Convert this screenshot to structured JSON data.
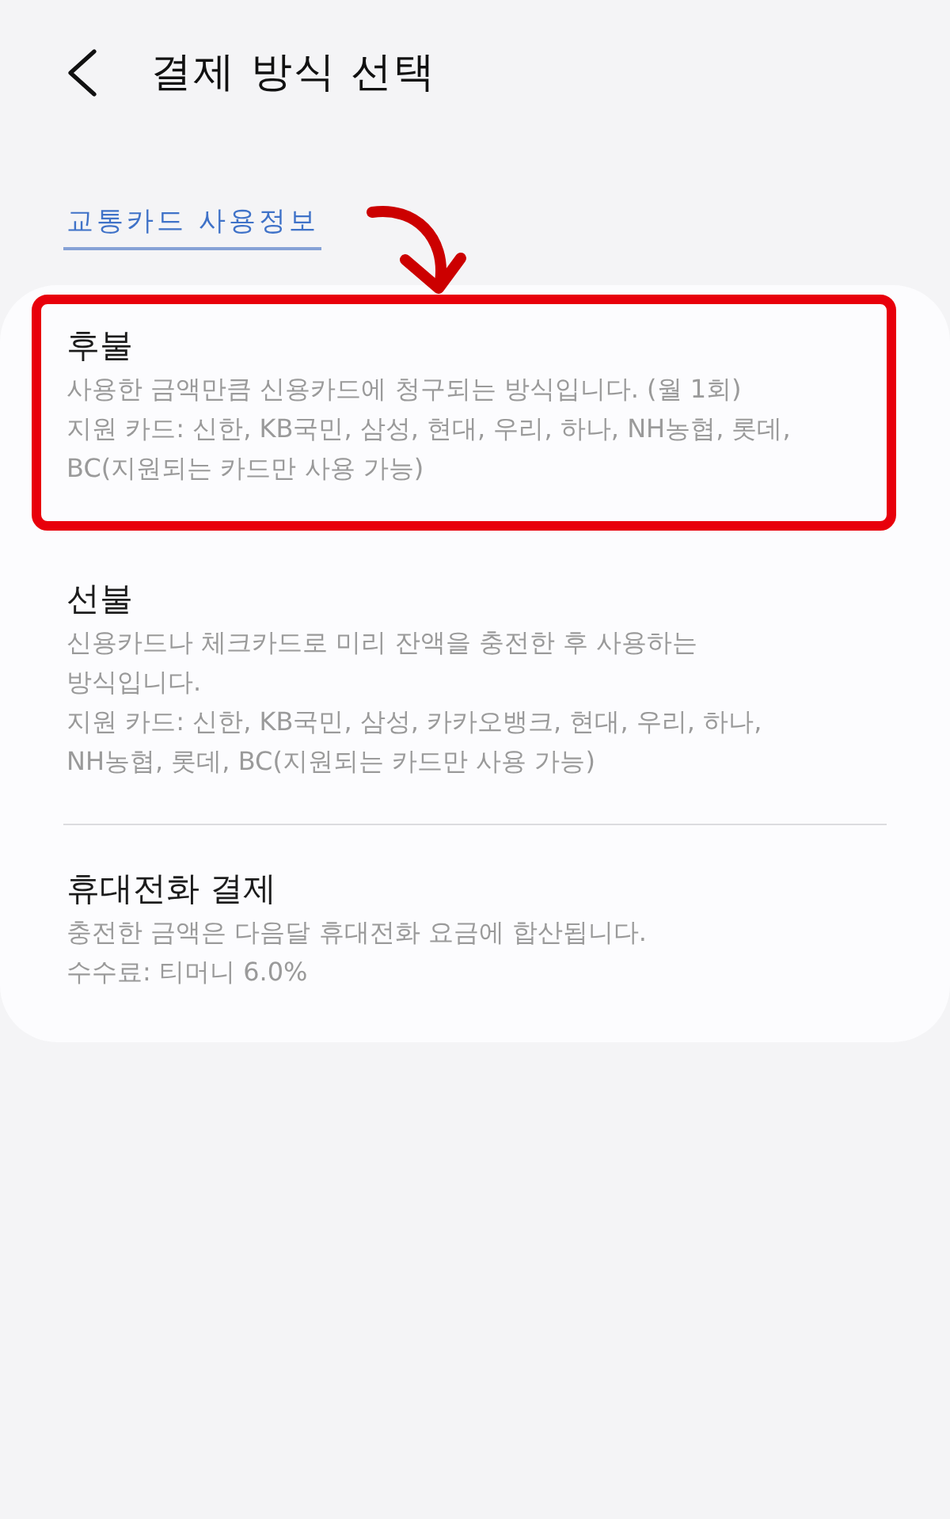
{
  "header": {
    "title": "결제 방식 선택"
  },
  "info_link": {
    "label": "교통카드 사용정보"
  },
  "groups": [
    {
      "options": [
        {
          "title": "후불",
          "highlighted": true,
          "details": [
            "사용한 금액만큼 신용카드에 청구되는 방식입니다. (월 1회)",
            "지원 카드: 신한, KB국민, 삼성, 현대, 우리, 하나, NH농협, 롯데, BC(지원되는 카드만 사용 가능)"
          ]
        },
        {
          "title": "선불",
          "highlighted": false,
          "details": [
            "신용카드나 체크카드로 미리 잔액을 충전한 후 사용하는 방식입니다.",
            "지원 카드: 신한, KB국민, 삼성, 카카오뱅크, 현대, 우리, 하나, NH농협, 롯데, BC(지원되는 카드만 사용 가능)"
          ]
        }
      ]
    },
    {
      "options": [
        {
          "title": "휴대전화 결제",
          "highlighted": false,
          "details": [
            "충전한 금액은 다음달 휴대전화 요금에 합산됩니다.",
            "수수료: 티머니 6.0%"
          ]
        }
      ]
    }
  ]
}
